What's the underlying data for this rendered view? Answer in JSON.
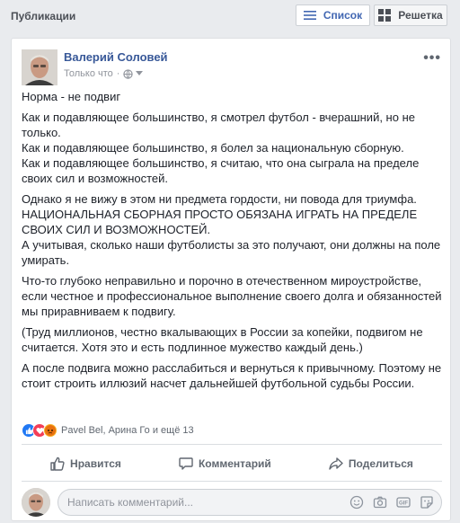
{
  "header": {
    "title": "Публикации",
    "list_label": "Список",
    "grid_label": "Решетка"
  },
  "post": {
    "author": "Валерий Соловей",
    "time": "Только что",
    "more": "•••",
    "paragraphs": [
      "Норма - не подвиг",
      "Как и подавляющее большинство, я смотрел футбол - вчерашний, но не только.\nКак и подавляющее большинство, я болел за национальную сборную.\nКак и подавляющее большинство, я считаю, что она сыграла на пределе своих сил и возможностей.",
      "Однако я не вижу в этом ни предмета гордости, ни повода для триумфа.\nНАЦИОНАЛЬНАЯ СБОРНАЯ ПРОСТО ОБЯЗАНА ИГРАТЬ НА ПРЕДЕЛЕ СВОИХ СИЛ И ВОЗМОЖНОСТЕЙ.\nА учитывая, сколько наши футболисты за это получают, они должны на поле умирать.",
      "Что-то глубоко неправильно и порочно в отечественном мироустройстве, если честное и профессиональное выполнение своего долга и обязанностей мы приравниваем к подвигу.",
      "(Труд миллионов, честно вкалывающих в России за копейки, подвигом не считается. Хотя это и есть подлинное мужество каждый день.)",
      "А после подвига можно расслабиться и вернуться к привычному. Поэтому не стоит строить иллюзий насчет дальнейшей футбольной судьбы России."
    ],
    "reactions_text": "Pavel Bel, Арина Го и ещё 13"
  },
  "actions": {
    "like": "Нравится",
    "comment": "Комментарий",
    "share": "Поделиться"
  },
  "comment_box": {
    "placeholder": "Написать комментарий..."
  },
  "colors": {
    "link": "#385898",
    "accent": "#4267b2",
    "background": "#e9ebee"
  }
}
